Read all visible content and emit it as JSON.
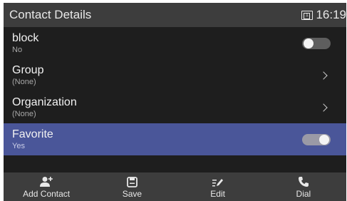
{
  "status_bar": {
    "title": "Contact Details",
    "line_number": "1",
    "time": "16:19"
  },
  "rows": [
    {
      "label": "block",
      "value": "No",
      "control": "toggle",
      "toggle_on": false
    },
    {
      "label": "Group",
      "value": "(None)",
      "control": "chevron"
    },
    {
      "label": "Organization",
      "value": "(None)",
      "control": "chevron"
    },
    {
      "label": "Favorite",
      "value": "Yes",
      "control": "toggle",
      "toggle_on": true,
      "selected": true
    }
  ],
  "softkeys": [
    {
      "label": "Add Contact",
      "icon": "add-contact-icon"
    },
    {
      "label": "Save",
      "icon": "save-icon"
    },
    {
      "label": "Edit",
      "icon": "edit-icon"
    },
    {
      "label": "Dial",
      "icon": "phone-icon"
    }
  ],
  "colors": {
    "background": "#1e1e1e",
    "bar": "#3d3d3d",
    "selected_row": "#4a5699",
    "text": "#f2f2f2"
  }
}
